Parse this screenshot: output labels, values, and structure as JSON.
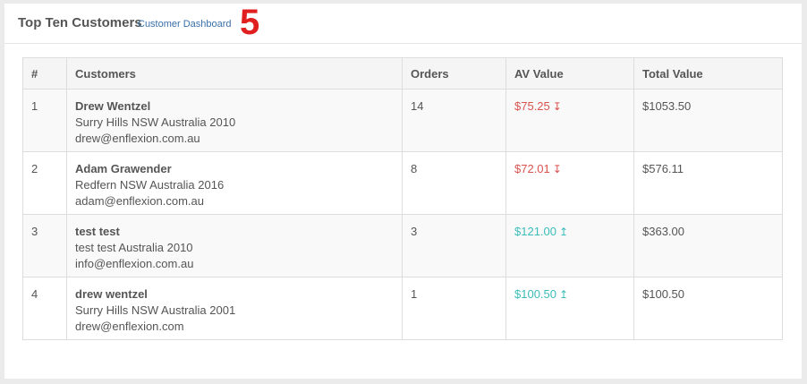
{
  "header": {
    "title": "Top Ten Customers",
    "link": "Customer Dashboard",
    "badge": "5"
  },
  "table": {
    "columns": [
      "#",
      "Customers",
      "Orders",
      "AV Value",
      "Total Value"
    ],
    "rows": [
      {
        "num": "1",
        "name": "Drew Wentzel",
        "address": "Surry Hills NSW Australia 2010",
        "email": "drew@enflexion.com.au",
        "orders": "14",
        "av": "$75.25",
        "trend": "down",
        "trend_icon": "↧",
        "total": "$1053.50"
      },
      {
        "num": "2",
        "name": "Adam Grawender",
        "address": "Redfern NSW Australia 2016",
        "email": "adam@enflexion.com.au",
        "orders": "8",
        "av": "$72.01",
        "trend": "down",
        "trend_icon": "↧",
        "total": "$576.11"
      },
      {
        "num": "3",
        "name": "test test",
        "address": "test test Australia 2010",
        "email": "info@enflexion.com.au",
        "orders": "3",
        "av": "$121.00",
        "trend": "up",
        "trend_icon": "↥",
        "total": "$363.00"
      },
      {
        "num": "4",
        "name": "drew wentzel",
        "address": "Surry Hills NSW Australia 2001",
        "email": "drew@enflexion.com",
        "orders": "1",
        "av": "$100.50",
        "trend": "up",
        "trend_icon": "↥",
        "total": "$100.50"
      }
    ]
  },
  "colors": {
    "down": "#d9534f",
    "up": "#3bbdbb",
    "badge": "#e02020",
    "link": "#3a6fa8"
  }
}
